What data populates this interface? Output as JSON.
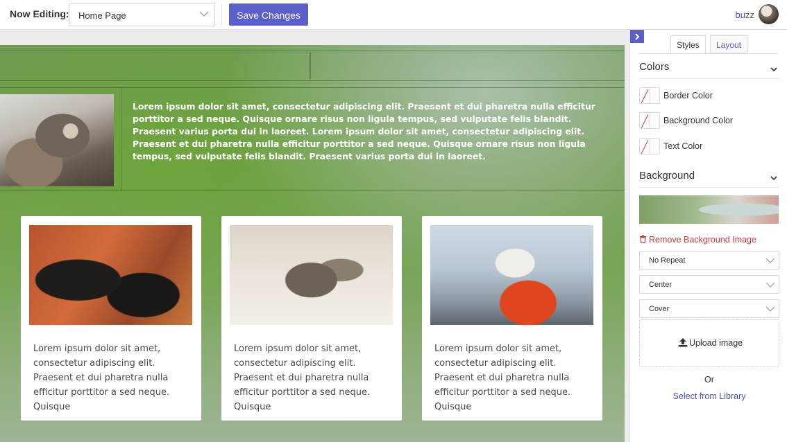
{
  "topbar": {
    "label": "Now Editing:",
    "page_select_value": "Home Page",
    "save_label": "Save Changes",
    "user_name": "buzz"
  },
  "hero": {
    "text": "Lorem ipsum dolor sit amet, consectetur adipiscing elit. Praesent et dui pharetra nulla efficitur porttitor a sed neque. Quisque ornare risus non ligula tempus, sed vulputate felis blandit. Praesent varius porta dui in laoreet. Lorem ipsum dolor sit amet, consectetur adipiscing elit. Praesent et dui pharetra nulla efficitur porttitor a sed neque. Quisque ornare risus non ligula tempus, sed vulputate felis blandit. Praesent varius porta dui in laoreet."
  },
  "cards": [
    {
      "text": "Lorem ipsum dolor sit amet, consectetur adipiscing elit. Praesent et dui pharetra nulla efficitur porttitor a sed neque. Quisque"
    },
    {
      "text": "Lorem ipsum dolor sit amet, consectetur adipiscing elit. Praesent et dui pharetra nulla efficitur porttitor a sed neque. Quisque"
    },
    {
      "text": "Lorem ipsum dolor sit amet, consectetur adipiscing elit. Praesent et dui pharetra nulla efficitur porttitor a sed neque. Quisque"
    }
  ],
  "panel": {
    "tabs": [
      "Styles",
      "Layout"
    ],
    "active_tab": "Styles",
    "colors_title": "Colors",
    "color_items": [
      "Border Color",
      "Background Color",
      "Text Color"
    ],
    "background_title": "Background",
    "remove_bg_label": "Remove Background Image",
    "repeat_value": "No Repeat",
    "position_value": "Center",
    "size_value": "Cover",
    "upload_label": "Upload image",
    "or_label": "Or",
    "library_label": "Select from Library"
  },
  "colors": {
    "accent": "#5b5fc7",
    "danger": "#d33b3b"
  }
}
